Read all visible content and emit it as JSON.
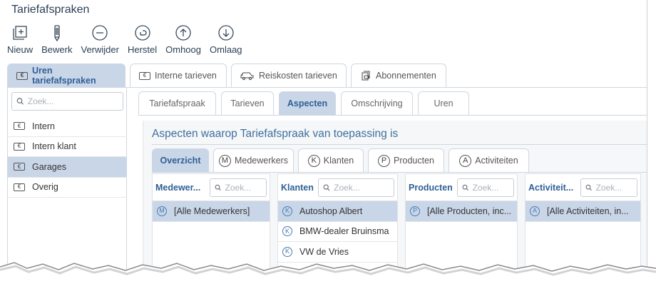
{
  "window": {
    "title": "Tariefafspraken"
  },
  "toolbar": {
    "new_label": "Nieuw",
    "edit_label": "Bewerk",
    "delete_label": "Verwijder",
    "restore_label": "Herstel",
    "up_label": "Omhoog",
    "down_label": "Omlaag"
  },
  "main_tabs": [
    {
      "label": "Uren tariefafspraken",
      "icon": "euro-card-icon",
      "active": true
    },
    {
      "label": "Interne tarieven",
      "icon": "euro-card-icon",
      "active": false
    },
    {
      "label": "Reiskosten tarieven",
      "icon": "car-icon",
      "active": false
    },
    {
      "label": "Abonnementen",
      "icon": "subscription-icon",
      "active": false
    }
  ],
  "sidebar": {
    "search_placeholder": "Zoek...",
    "items": [
      {
        "label": "Intern",
        "icon": "euro-card-icon",
        "selected": false
      },
      {
        "label": "Intern klant",
        "icon": "euro-card-icon",
        "selected": false
      },
      {
        "label": "Garages",
        "icon": "euro-card-icon",
        "selected": true
      },
      {
        "label": "Overig",
        "icon": "euro-card-icon",
        "selected": false
      }
    ]
  },
  "sub_tabs": [
    {
      "label": "Tariefafspraak",
      "active": false
    },
    {
      "label": "Tarieven",
      "active": false
    },
    {
      "label": "Aspecten",
      "active": true
    },
    {
      "label": "Omschrijving",
      "active": false
    },
    {
      "label": "Uren",
      "active": false
    }
  ],
  "aspects": {
    "title": "Aspecten waarop Tariefafspraak van toepassing is",
    "tabs": [
      {
        "label": "Overzicht",
        "letter": "",
        "active": true
      },
      {
        "label": "Medewerkers",
        "letter": "M",
        "active": false
      },
      {
        "label": "Klanten",
        "letter": "K",
        "active": false
      },
      {
        "label": "Producten",
        "letter": "P",
        "active": false
      },
      {
        "label": "Activiteiten",
        "letter": "A",
        "active": false
      }
    ],
    "columns": [
      {
        "header": "Medewer...",
        "search_placeholder": "Zoek...",
        "letter": "M",
        "rows": [
          {
            "label": "[Alle Medewerkers]",
            "selected": true
          }
        ]
      },
      {
        "header": "Klanten",
        "search_placeholder": "Zoek...",
        "letter": "K",
        "rows": [
          {
            "label": "Autoshop Albert",
            "selected": true
          },
          {
            "label": "BMW-dealer Bruinsma",
            "selected": false
          },
          {
            "label": "VW de Vries",
            "selected": false
          }
        ]
      },
      {
        "header": "Producten",
        "search_placeholder": "Zoek...",
        "letter": "P",
        "rows": [
          {
            "label": "[Alle Producten, inc...",
            "selected": true
          }
        ]
      },
      {
        "header": "Activiteit...",
        "search_placeholder": "Zoek...",
        "letter": "A",
        "rows": [
          {
            "label": "[Alle Activiteiten, in...",
            "selected": true
          }
        ]
      }
    ]
  },
  "colors": {
    "accent": "#2f5f94",
    "selected_bg": "#c9d6e8",
    "title": "#3f6f9e"
  }
}
